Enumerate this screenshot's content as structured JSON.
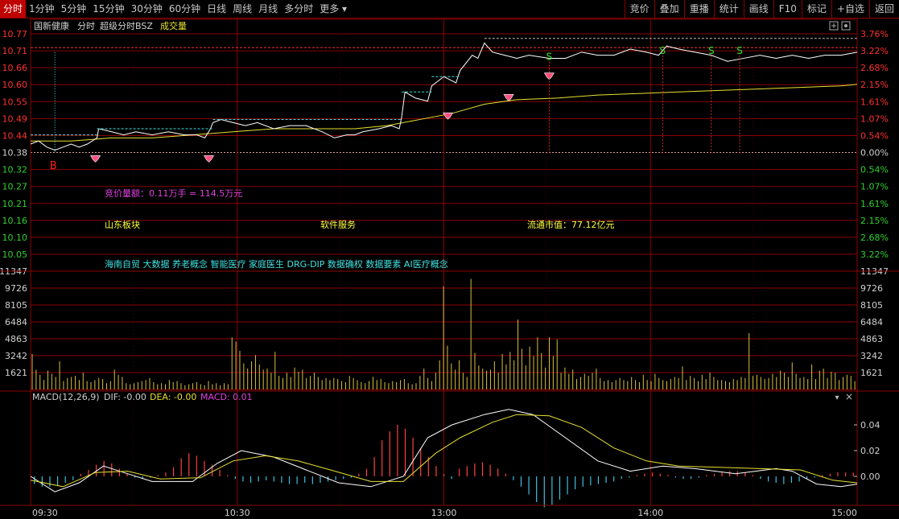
{
  "toolbar": {
    "periods": [
      "分时",
      "1分钟",
      "5分钟",
      "15分钟",
      "30分钟",
      "60分钟",
      "日线",
      "周线",
      "月线",
      "多分时",
      "更多"
    ],
    "active_period": "分时",
    "right_buttons": [
      "竞价",
      "叠加",
      "重播",
      "统计",
      "画线",
      "F10",
      "标记",
      "+自选",
      "返回"
    ]
  },
  "header": {
    "stock_name": "国新健康",
    "mode": "分时",
    "indicator": "超级分时BSZ",
    "volume_label": "成交量"
  },
  "price_axis": {
    "left_ticks": [
      "10.77",
      "10.71",
      "10.66",
      "10.60",
      "10.55",
      "10.49",
      "10.44",
      "10.38",
      "10.32",
      "10.27",
      "10.21",
      "10.16",
      "10.10",
      "10.05"
    ],
    "right_ticks": [
      "3.76%",
      "3.22%",
      "2.68%",
      "2.15%",
      "1.61%",
      "1.07%",
      "0.54%",
      "0.00%",
      "0.54%",
      "1.07%",
      "1.61%",
      "2.15%",
      "2.68%",
      "3.22%"
    ],
    "prev_close": 10.38
  },
  "volume_axis": {
    "ticks": [
      "11347",
      "9726",
      "8105",
      "6484",
      "4863",
      "3242",
      "1621"
    ]
  },
  "macd": {
    "label": "MACD(12,26,9)",
    "dif": "DIF: -0.00",
    "dea": "DEA: -0.00",
    "macd": "MACD: 0.01",
    "ticks": [
      "0.04",
      "0.02",
      "0.00"
    ]
  },
  "time_axis": [
    "09:30",
    "10:30",
    "13:00",
    "14:00",
    "15:00"
  ],
  "info": {
    "auction": "竞价量额：0.11万手 = 114.5万元",
    "sector_region": "山东板块",
    "sector_industry": "软件服务",
    "float_cap": "流通市值：77.12亿元",
    "concepts": "海南自贸 大数据 养老概念 智能医疗 家庭医生 DRG-DIP 数据确权 数据要素 AI医疗概念"
  },
  "signals": {
    "buy_label": "B",
    "sell_label": "S"
  },
  "colors": {
    "grid": "#8b0000",
    "price": "#ffffff",
    "avg": "#e8e030",
    "up": "#ff3030",
    "down": "#30d030",
    "auction_text": "#e040e0",
    "sector_text": "#ffff40",
    "concept_text": "#40e0e0",
    "vol_bar": "#d8c040",
    "macd_up": "#ff4040",
    "macd_down": "#40c0e0"
  },
  "chart_data": {
    "type": "line",
    "price_path": [
      [
        0,
        10.41
      ],
      [
        10,
        10.42
      ],
      [
        20,
        10.4
      ],
      [
        30,
        10.39
      ],
      [
        40,
        10.4
      ],
      [
        50,
        10.41
      ],
      [
        60,
        10.4
      ],
      [
        70,
        10.41
      ],
      [
        82,
        10.43
      ],
      [
        84,
        10.46
      ],
      [
        100,
        10.45
      ],
      [
        115,
        10.44
      ],
      [
        130,
        10.45
      ],
      [
        150,
        10.44
      ],
      [
        170,
        10.45
      ],
      [
        190,
        10.44
      ],
      [
        205,
        10.44
      ],
      [
        215,
        10.43
      ],
      [
        222,
        10.46
      ],
      [
        225,
        10.48
      ],
      [
        235,
        10.49
      ],
      [
        250,
        10.48
      ],
      [
        265,
        10.47
      ],
      [
        280,
        10.48
      ],
      [
        300,
        10.46
      ],
      [
        320,
        10.47
      ],
      [
        340,
        10.47
      ],
      [
        360,
        10.45
      ],
      [
        375,
        10.43
      ],
      [
        390,
        10.44
      ],
      [
        400,
        10.44
      ],
      [
        410,
        10.45
      ],
      [
        430,
        10.46
      ],
      [
        445,
        10.47
      ],
      [
        455,
        10.46
      ],
      [
        458,
        10.5
      ],
      [
        462,
        10.58
      ],
      [
        475,
        10.56
      ],
      [
        490,
        10.55
      ],
      [
        495,
        10.6
      ],
      [
        510,
        10.63
      ],
      [
        525,
        10.61
      ],
      [
        530,
        10.65
      ],
      [
        545,
        10.7
      ],
      [
        552,
        10.69
      ],
      [
        560,
        10.74
      ],
      [
        570,
        10.71
      ],
      [
        585,
        10.7
      ],
      [
        600,
        10.69
      ],
      [
        615,
        10.7
      ],
      [
        640,
        10.69
      ],
      [
        660,
        10.69
      ],
      [
        680,
        10.71
      ],
      [
        700,
        10.7
      ],
      [
        720,
        10.7
      ],
      [
        740,
        10.72
      ],
      [
        760,
        10.71
      ],
      [
        775,
        10.7
      ],
      [
        785,
        10.73
      ],
      [
        800,
        10.72
      ],
      [
        820,
        10.71
      ],
      [
        840,
        10.7
      ],
      [
        860,
        10.68
      ],
      [
        880,
        10.69
      ],
      [
        900,
        10.7
      ],
      [
        920,
        10.69
      ],
      [
        940,
        10.7
      ],
      [
        960,
        10.69
      ],
      [
        980,
        10.7
      ],
      [
        1000,
        10.7
      ],
      [
        1020,
        10.71
      ]
    ],
    "avg_path": [
      [
        0,
        10.42
      ],
      [
        50,
        10.42
      ],
      [
        100,
        10.43
      ],
      [
        150,
        10.43
      ],
      [
        200,
        10.44
      ],
      [
        250,
        10.45
      ],
      [
        300,
        10.46
      ],
      [
        350,
        10.46
      ],
      [
        400,
        10.46
      ],
      [
        440,
        10.47
      ],
      [
        480,
        10.49
      ],
      [
        520,
        10.51
      ],
      [
        560,
        10.54
      ],
      [
        600,
        10.555
      ],
      [
        650,
        10.56
      ],
      [
        700,
        10.57
      ],
      [
        750,
        10.575
      ],
      [
        800,
        10.58
      ],
      [
        850,
        10.585
      ],
      [
        900,
        10.59
      ],
      [
        950,
        10.595
      ],
      [
        1000,
        10.6
      ],
      [
        1020,
        10.605
      ]
    ],
    "buy_signals": [
      [
        80,
        10.38
      ],
      [
        220,
        10.38
      ],
      [
        515,
        10.52
      ],
      [
        590,
        10.58
      ],
      [
        640,
        10.65
      ]
    ],
    "sell_signals": [
      [
        640,
        10.69
      ],
      [
        780,
        10.71
      ],
      [
        840,
        10.71
      ],
      [
        875,
        10.71
      ]
    ],
    "volume": [
      3400,
      1900,
      1400,
      900,
      1800,
      1500,
      1200,
      2700,
      800,
      1100,
      1200,
      1300,
      900,
      1600,
      800,
      700,
      900,
      1100,
      1000,
      600,
      800,
      1900,
      1400,
      1200,
      600,
      500,
      600,
      700,
      800,
      900,
      1100,
      700,
      500,
      600,
      500,
      900,
      700,
      800,
      600,
      400,
      500,
      600,
      700,
      500,
      400,
      800,
      500,
      600,
      400,
      600,
      500,
      5000,
      4600,
      3700,
      2500,
      2000,
      2700,
      3300,
      2400,
      1900,
      2000,
      1600,
      3600,
      1300,
      1100,
      1600,
      1200,
      2100,
      1700,
      1900,
      1100,
      1300,
      1600,
      1200,
      900,
      1100,
      900,
      1100,
      1000,
      800,
      700,
      1300,
      1100,
      900,
      700,
      600,
      800,
      1200,
      900,
      1000,
      700,
      600,
      800,
      700,
      900,
      1000,
      600,
      500,
      600,
      1300,
      2000,
      1100,
      800,
      1600,
      2800,
      9900,
      4200,
      2500,
      1900,
      2800,
      1600,
      1200,
      10600,
      3500,
      2300,
      2000,
      1800,
      1900,
      2700,
      1600,
      3400,
      2400,
      3600,
      2800,
      6700,
      3900,
      2300,
      4100,
      3200,
      5000,
      3500,
      2100,
      5000,
      3200,
      4800,
      1600,
      2100,
      1500,
      1900,
      1000,
      1200,
      1500,
      1300,
      1600,
      2000,
      1100,
      800,
      900,
      700,
      900,
      1100,
      900,
      800,
      1200,
      900,
      700,
      1400,
      900,
      800,
      1500,
      1100,
      900,
      800,
      1000,
      1200,
      1100,
      2200,
      900,
      1300,
      1100,
      800,
      1400,
      1000,
      1600,
      1200,
      900,
      900,
      800,
      700,
      1000,
      900,
      1200,
      1100,
      5400,
      1300,
      1400,
      1200,
      1000,
      1100,
      1500,
      1200,
      1800,
      1600,
      1200,
      2600,
      1500,
      1100,
      1200,
      1000,
      2400,
      1000,
      1800,
      2000,
      1100,
      1700,
      1600,
      900,
      1200,
      1400,
      1300,
      800
    ],
    "macd_bars": [
      -0.006,
      -0.008,
      -0.008,
      -0.007,
      -0.005,
      -0.003,
      0.002,
      0.005,
      0.009,
      0.012,
      0.01,
      0.006,
      0.002,
      -0.001,
      -0.002,
      -0.001,
      0.001,
      0.003,
      0.007,
      0.014,
      0.018,
      0.016,
      0.012,
      0.009,
      0.005,
      0.001,
      -0.002,
      -0.004,
      -0.005,
      -0.004,
      -0.003,
      -0.004,
      -0.005,
      -0.006,
      -0.006,
      -0.005,
      -0.006,
      -0.005,
      -0.004,
      -0.003,
      -0.002,
      -0.001,
      0.002,
      0.006,
      0.015,
      0.028,
      0.035,
      0.04,
      0.037,
      0.03,
      0.022,
      0.015,
      0.008,
      0.002,
      -0.002,
      0.006,
      0.008,
      0.01,
      0.011,
      0.009,
      0.006,
      0.002,
      -0.003,
      -0.008,
      -0.014,
      -0.02,
      -0.024,
      -0.022,
      -0.018,
      -0.014,
      -0.01,
      -0.008,
      -0.007,
      -0.006,
      -0.005,
      -0.004,
      -0.002,
      -0.001,
      0.001,
      0.002,
      0.003,
      0.002,
      0.001,
      -0.001,
      -0.002,
      -0.002,
      -0.001,
      0.001,
      0.002,
      0.003,
      0.004,
      0.004,
      0.003,
      0.001,
      -0.002,
      -0.004,
      -0.005,
      -0.006,
      -0.005,
      -0.004,
      -0.002,
      -0.001,
      0.001,
      0.002,
      0.003,
      0.003,
      0.003
    ],
    "dif_path": [
      [
        0,
        0.0
      ],
      [
        30,
        -0.012
      ],
      [
        60,
        -0.005
      ],
      [
        90,
        0.008
      ],
      [
        120,
        0.002
      ],
      [
        150,
        -0.004
      ],
      [
        200,
        -0.004
      ],
      [
        230,
        0.01
      ],
      [
        260,
        0.02
      ],
      [
        300,
        0.015
      ],
      [
        340,
        0.005
      ],
      [
        380,
        -0.005
      ],
      [
        420,
        -0.008
      ],
      [
        460,
        0.0
      ],
      [
        490,
        0.03
      ],
      [
        520,
        0.04
      ],
      [
        560,
        0.048
      ],
      [
        590,
        0.052
      ],
      [
        620,
        0.048
      ],
      [
        660,
        0.03
      ],
      [
        700,
        0.012
      ],
      [
        740,
        0.004
      ],
      [
        780,
        0.008
      ],
      [
        820,
        0.006
      ],
      [
        870,
        0.002
      ],
      [
        920,
        0.006
      ],
      [
        940,
        0.004
      ],
      [
        970,
        -0.006
      ],
      [
        1000,
        -0.008
      ],
      [
        1020,
        -0.006
      ]
    ],
    "dea_path": [
      [
        0,
        -0.003
      ],
      [
        40,
        -0.008
      ],
      [
        80,
        0.003
      ],
      [
        120,
        0.004
      ],
      [
        160,
        -0.002
      ],
      [
        210,
        -0.001
      ],
      [
        250,
        0.012
      ],
      [
        290,
        0.016
      ],
      [
        330,
        0.012
      ],
      [
        370,
        0.005
      ],
      [
        420,
        -0.004
      ],
      [
        460,
        -0.004
      ],
      [
        500,
        0.018
      ],
      [
        530,
        0.03
      ],
      [
        570,
        0.042
      ],
      [
        600,
        0.048
      ],
      [
        640,
        0.047
      ],
      [
        680,
        0.038
      ],
      [
        720,
        0.022
      ],
      [
        760,
        0.012
      ],
      [
        800,
        0.008
      ],
      [
        850,
        0.007
      ],
      [
        900,
        0.006
      ],
      [
        950,
        0.005
      ],
      [
        990,
        -0.003
      ],
      [
        1020,
        -0.005
      ]
    ]
  }
}
